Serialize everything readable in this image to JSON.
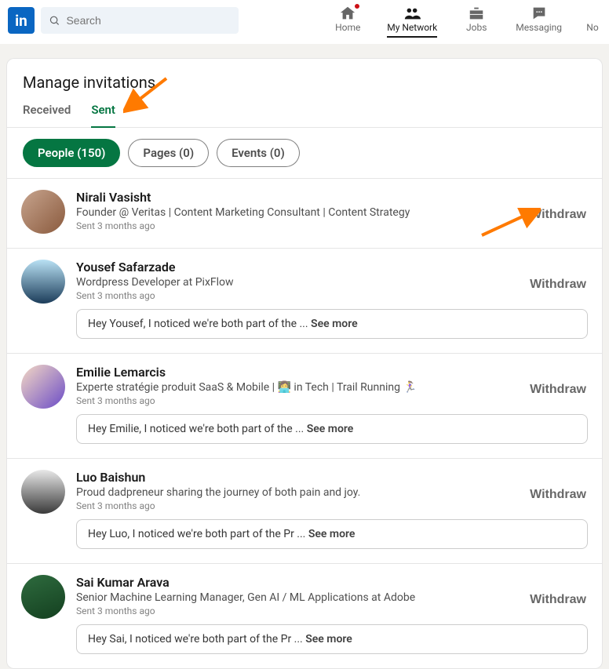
{
  "header": {
    "logo_text": "in",
    "search_placeholder": "Search",
    "nav": {
      "home": "Home",
      "network": "My Network",
      "jobs": "Jobs",
      "messaging": "Messaging",
      "notifications_partial": "No"
    }
  },
  "page": {
    "title": "Manage invitations",
    "tabs": {
      "received": "Received",
      "sent": "Sent"
    },
    "filters": {
      "people": "People (150)",
      "pages": "Pages (0)",
      "events": "Events (0)"
    },
    "withdraw_label": "Withdraw",
    "see_more_label": "See more"
  },
  "invites": [
    {
      "name": "Nirali Vasisht",
      "headline": "Founder @ Veritas | Content Marketing Consultant | Content Strategy",
      "sent": "Sent 3 months ago",
      "avatar_bg": "linear-gradient(135deg,#c7a48e,#8a5a3d)"
    },
    {
      "name": "Yousef Safarzade",
      "headline": "Wordpress Developer at PixFlow",
      "sent": "Sent 3 months ago",
      "message": "Hey Yousef, I noticed we're both part of the ... ",
      "avatar_bg": "linear-gradient(180deg,#b9e1f4,#1c3d5a)"
    },
    {
      "name": "Emilie Lemarcis",
      "headline": "Experte stratégie produit SaaS & Mobile | 👩‍💻 in Tech | Trail Running 🏃‍♀️",
      "sent": "Sent 3 months ago",
      "message": "Hey Emilie, I noticed we're both part of the ... ",
      "avatar_bg": "linear-gradient(135deg,#f5d9c4,#6b4cc7)"
    },
    {
      "name": "Luo Baishun",
      "headline": "Proud dadpreneur sharing the journey of both pain and joy.",
      "sent": "Sent 3 months ago",
      "message": "Hey Luo, I noticed we're both part of the Pr ... ",
      "avatar_bg": "linear-gradient(180deg,#e8e8e8,#3a3a3a)"
    },
    {
      "name": "Sai Kumar Arava",
      "headline": "Senior Machine Learning Manager, Gen AI / ML Applications at Adobe",
      "sent": "Sent 3 months ago",
      "message": "Hey Sai, I noticed we're both part of the Pr ... ",
      "avatar_bg": "linear-gradient(160deg,#2e6b3e,#144020)"
    }
  ]
}
